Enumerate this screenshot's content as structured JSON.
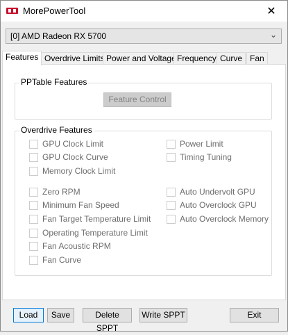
{
  "window": {
    "title": "MorePowerTool",
    "close_glyph": "✕"
  },
  "device": {
    "selected": "[0] AMD Radeon RX 5700",
    "chevron": "⌄"
  },
  "tabs": [
    {
      "label": "Features",
      "active": true
    },
    {
      "label": "Overdrive Limits",
      "active": false
    },
    {
      "label": "Power and Voltage",
      "active": false
    },
    {
      "label": "Frequency",
      "active": false
    },
    {
      "label": "Curve",
      "active": false
    },
    {
      "label": "Fan",
      "active": false
    }
  ],
  "pptable": {
    "title": "PPTable Features",
    "feature_control_label": "Feature Control"
  },
  "overdrive": {
    "title": "Overdrive Features",
    "left": [
      "GPU Clock Limit",
      "GPU Clock Curve",
      "Memory Clock Limit",
      "Zero RPM",
      "Minimum Fan Speed",
      "Fan Target Temperature Limit",
      "Operating Temperature Limit",
      "Fan Acoustic RPM",
      "Fan Curve"
    ],
    "right": [
      "Power Limit",
      "Timing Tuning",
      "Auto Undervolt GPU",
      "Auto Overclock GPU",
      "Auto Overclock Memory"
    ]
  },
  "buttons": {
    "load": "Load",
    "save": "Save",
    "delete_sppt": "Delete SPPT",
    "write_sppt": "Write SPPT",
    "exit": "Exit"
  },
  "colors": {
    "accent_focus": "#0078d7",
    "app_icon": "#c8102e",
    "disabled_text": "#6d6d6d"
  }
}
